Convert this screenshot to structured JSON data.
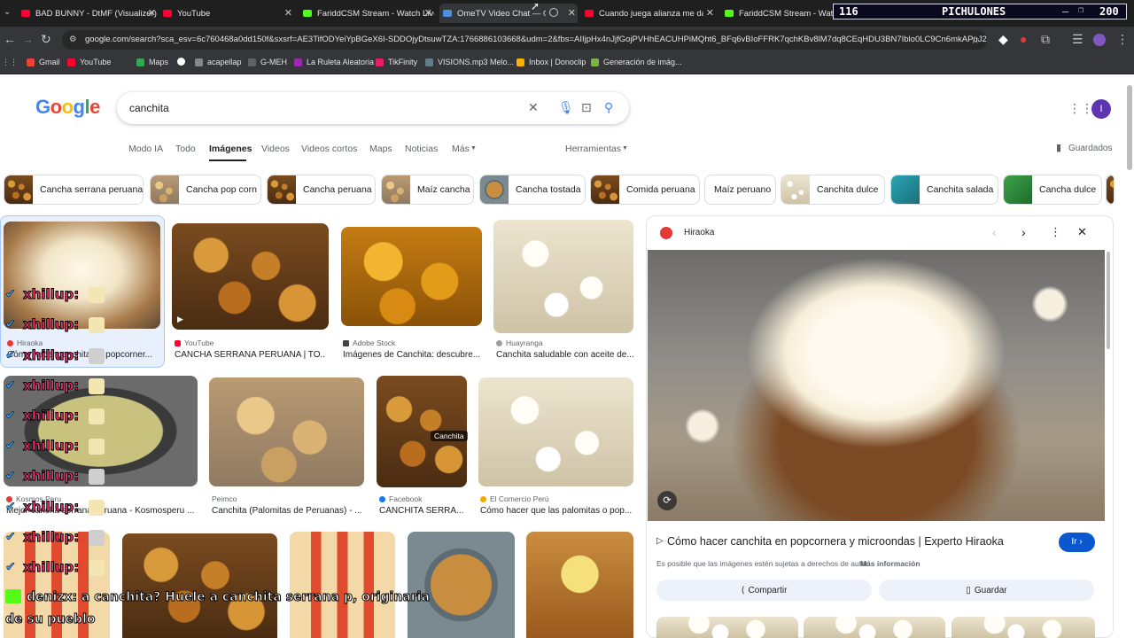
{
  "tabs": [
    {
      "label": "BAD BUNNY - DtMF (Visualizer)",
      "color": "#ff0033"
    },
    {
      "label": "YouTube",
      "color": "#ff0033"
    },
    {
      "label": "FariddCSM Stream - Watch Live",
      "color": "#53fc18"
    },
    {
      "label": "OmeTV Video Chat — Omegle",
      "color": "#4a90e2"
    },
    {
      "label": "Cuando juega alianza me da pla",
      "color": "#ff0033"
    },
    {
      "label": "FariddCSM Stream - Watch Li",
      "color": "#53fc18"
    }
  ],
  "stream_overlay": {
    "left": "116",
    "center": "PICHULONES",
    "right": "200"
  },
  "address": {
    "url": "google.com/search?sca_esv=6c760468a0dd150f&sxsrf=AE3TifODYeiYpBGeX6I-SDDOjyDtsuwTZA:1766886103668&udm=2&fbs=AIIjpHx4nJjfGojPVHhEACUHPiMQht6_BFq6vBIoFFRK7qchKBv8lM7dq8CEqHDU3BN7Iblo0LC9Cn6mkAPuJ2p..."
  },
  "bookmarks": [
    {
      "label": "Gmail",
      "color": "#ea4335"
    },
    {
      "label": "YouTube",
      "color": "#ff0033"
    },
    {
      "label": "Maps",
      "color": "#34a853"
    },
    {
      "label": "",
      "color": "#ffffff"
    },
    {
      "label": "acapellap",
      "color": "#888888"
    },
    {
      "label": "G-MEH",
      "color": "#5f6368"
    },
    {
      "label": "La Ruleta Aleatoria",
      "color": "#9c27b0"
    },
    {
      "label": "TikFinity",
      "color": "#e91e63"
    },
    {
      "label": "VISIONS.mp3 Melo...",
      "color": "#607d8b"
    },
    {
      "label": "Inbox | Donoclip",
      "color": "#ffb300"
    },
    {
      "label": "Generación de imág...",
      "color": "#7cb342"
    }
  ],
  "search": {
    "query": "canchita"
  },
  "google_tabs": [
    "Modo IA",
    "Todo",
    "Imágenes",
    "Videos",
    "Videos cortos",
    "Maps",
    "Noticias",
    "Más"
  ],
  "tools_label": "Herramientas",
  "saved_label": "Guardados",
  "chips": [
    "Cancha serrana peruana",
    "Cancha pop corn",
    "Cancha peruana",
    "Maíz cancha",
    "Cancha tostada",
    "Comida peruana",
    "Maíz peruano",
    "Canchita dulce",
    "Canchita salada",
    "Cancha dulce"
  ],
  "results": [
    {
      "source": "Hiraoka",
      "title": "Cómo hacer canchita en popcorner..."
    },
    {
      "source": "YouTube",
      "title": "CANCHA SERRANA PERUANA | TO..."
    },
    {
      "source": "Adobe Stock",
      "title": "Imágenes de Canchita: descubre..."
    },
    {
      "source": "Huayranga",
      "title": "Canchita saludable con aceite de..."
    },
    {
      "source": "Kosmos Peru",
      "title": "Mejor cancha serrana peruana - Kosmosperu ..."
    },
    {
      "source": "Peimco",
      "title": "Canchita (Palomitas de Peruanas) - ..."
    },
    {
      "source": "Facebook",
      "title": "CANCHITA SERRA..."
    },
    {
      "source": "El Comercio Perú",
      "title": "Cómo hacer que las palomitas o pop..."
    }
  ],
  "canchita_label": "Canchita",
  "panel": {
    "source": "Hiraoka",
    "title": "Cómo hacer canchita en popcornera y microondas | Experto Hiraoka",
    "visit": "Ir",
    "copyright": "Es posible que las imágenes estén sujetas a derechos de autor.",
    "more_info": "Más información",
    "share": "Compartir",
    "save": "Guardar"
  },
  "chat": {
    "username": "xhillup:",
    "message_line1": "denizx: a canchita? Huele a canchita serrana p, originaria",
    "message_line2": "de su pueblo"
  }
}
